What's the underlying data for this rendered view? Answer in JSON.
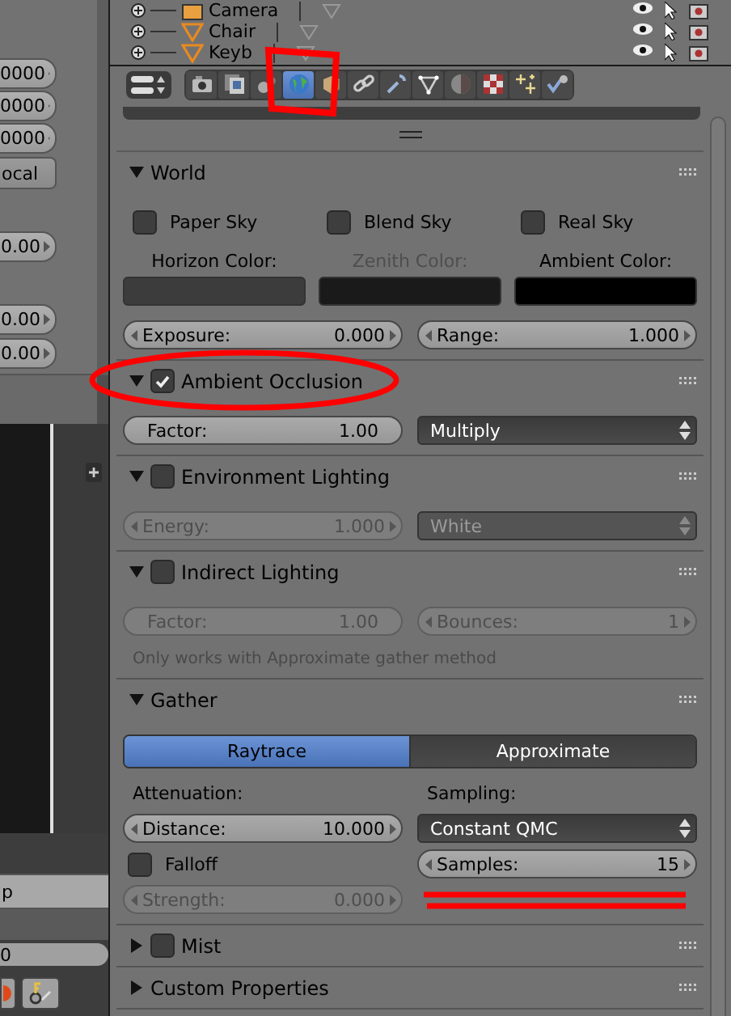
{
  "left_panel": {
    "fields": [
      "0000",
      "0000",
      "0000"
    ],
    "button": "ocal",
    "values": [
      "0.00",
      "0.00",
      "0.00"
    ],
    "mode_field": "p",
    "frame_field": "0"
  },
  "outliner": {
    "rows": [
      {
        "name": "Camera",
        "kind": "camera"
      },
      {
        "name": "Chair",
        "kind": "mesh"
      },
      {
        "name": "Keyb",
        "kind": "mesh"
      }
    ]
  },
  "property_tabs": [
    {
      "kind": "render",
      "selected": false
    },
    {
      "kind": "layers",
      "selected": false
    },
    {
      "kind": "scene",
      "selected": false
    },
    {
      "kind": "world",
      "selected": true
    },
    {
      "kind": "object",
      "selected": false
    },
    {
      "kind": "constraints",
      "selected": false
    },
    {
      "kind": "modifiers",
      "selected": false
    },
    {
      "kind": "data",
      "selected": false
    },
    {
      "kind": "material",
      "selected": false
    },
    {
      "kind": "texture",
      "selected": false
    },
    {
      "kind": "particles",
      "selected": false
    },
    {
      "kind": "physics",
      "selected": false
    }
  ],
  "panels": [
    {
      "title": "World",
      "expanded": true,
      "rows": [
        {
          "kind": "checks",
          "items": [
            {
              "label": "Paper Sky",
              "checked": false
            },
            {
              "label": "Blend Sky",
              "checked": false
            },
            {
              "label": "Real Sky",
              "checked": false
            }
          ]
        },
        {
          "kind": "colors",
          "items": [
            {
              "label": "Horizon Color:",
              "color": "#3c3c3c",
              "disabled": false
            },
            {
              "label": "Zenith Color:",
              "color": "#1a1a1a",
              "disabled": true
            },
            {
              "label": "Ambient Color:",
              "color": "#000000",
              "disabled": false
            }
          ]
        },
        {
          "kind": "pair",
          "items": [
            {
              "kind": "number",
              "label": "Exposure:",
              "value": "0.000",
              "disabled": false
            },
            {
              "kind": "number",
              "label": "Range:",
              "value": "1.000",
              "disabled": false
            }
          ]
        }
      ]
    },
    {
      "title": "Ambient Occlusion",
      "expanded": true,
      "checked": true,
      "rows": [
        {
          "kind": "pair",
          "items": [
            {
              "kind": "slider",
              "label": "Factor:",
              "value": "1.00",
              "disabled": false
            },
            {
              "kind": "dropdown",
              "value": "Multiply",
              "disabled": false
            }
          ]
        }
      ]
    },
    {
      "title": "Environment Lighting",
      "expanded": true,
      "checked": false,
      "rows": [
        {
          "kind": "pair",
          "items": [
            {
              "kind": "number",
              "label": "Energy:",
              "value": "1.000",
              "disabled": true
            },
            {
              "kind": "dropdown",
              "value": "White",
              "disabled": true
            }
          ]
        }
      ]
    },
    {
      "title": "Indirect Lighting",
      "expanded": true,
      "checked": false,
      "rows": [
        {
          "kind": "pair",
          "items": [
            {
              "kind": "slider",
              "label": "Factor:",
              "value": "1.00",
              "disabled": true
            },
            {
              "kind": "number",
              "label": "Bounces:",
              "value": "1",
              "disabled": true
            }
          ]
        },
        {
          "kind": "note",
          "text": "Only works with Approximate gather method"
        }
      ]
    },
    {
      "title": "Gather",
      "expanded": true,
      "rows": [
        {
          "kind": "segmented",
          "items": [
            {
              "label": "Raytrace",
              "selected": true
            },
            {
              "label": "Approximate",
              "selected": false
            }
          ]
        },
        {
          "kind": "columns",
          "columns": [
            {
              "heading": "Attenuation:",
              "items": [
                {
                  "kind": "number",
                  "label": "Distance:",
                  "value": "10.000",
                  "disabled": false
                },
                {
                  "kind": "check",
                  "label": "Falloff",
                  "checked": false
                },
                {
                  "kind": "number",
                  "label": "Strength:",
                  "value": "0.000",
                  "disabled": true
                }
              ]
            },
            {
              "heading": "Sampling:",
              "items": [
                {
                  "kind": "dropdown",
                  "value": "Constant QMC",
                  "disabled": false
                },
                {
                  "kind": "number",
                  "label": "Samples:",
                  "value": "15",
                  "disabled": false
                }
              ]
            }
          ]
        }
      ]
    },
    {
      "title": "Mist",
      "expanded": false,
      "checked": false
    },
    {
      "title": "Custom Properties",
      "expanded": false
    }
  ]
}
